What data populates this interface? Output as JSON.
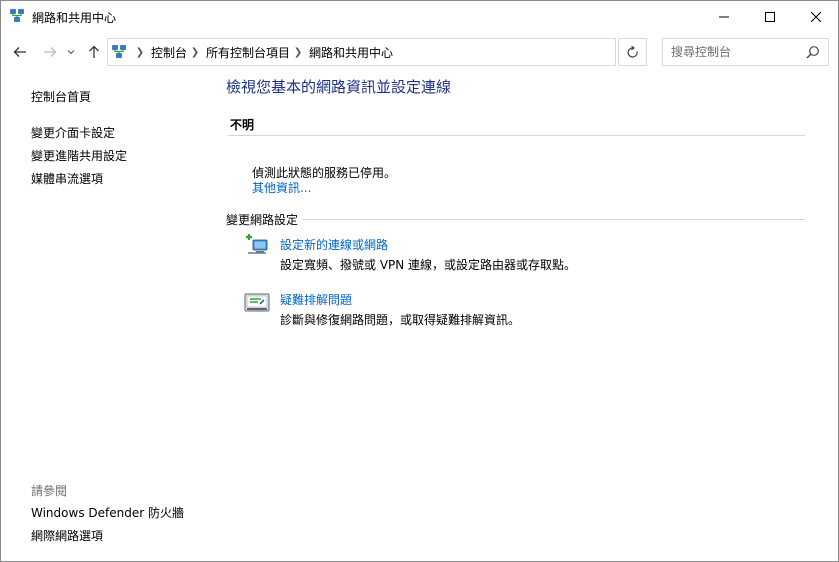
{
  "window": {
    "title": "網路和共用中心"
  },
  "address": {
    "crumbs": [
      "控制台",
      "所有控制台項目",
      "網路和共用中心"
    ]
  },
  "search": {
    "placeholder": "搜尋控制台"
  },
  "sidebar": {
    "home": "控制台首頁",
    "links": [
      "變更介面卡設定",
      "變更進階共用設定",
      "媒體串流選項"
    ],
    "see_also_label": "請參閱",
    "see_also": [
      "Windows Defender 防火牆",
      "網際網路選項"
    ]
  },
  "main": {
    "title": "檢視您基本的網路資訊並設定連線",
    "network_name": "不明",
    "status_message": "偵測此狀態的服務已停用。",
    "more_info": "其他資訊...",
    "change_section": "變更網路設定",
    "tasks": [
      {
        "title": "設定新的連線或網路",
        "description": "設定寬頻、撥號或 VPN 連線，或設定路由器或存取點。",
        "icon": "new-connection-icon"
      },
      {
        "title": "疑難排解問題",
        "description": "診斷與修復網路問題，或取得疑難排解資訊。",
        "icon": "troubleshoot-icon"
      }
    ]
  },
  "colors": {
    "title_blue": "#1e3287",
    "link_blue": "#0066cc",
    "muted": "#6d6d6d",
    "divider": "#d6d6d6"
  }
}
